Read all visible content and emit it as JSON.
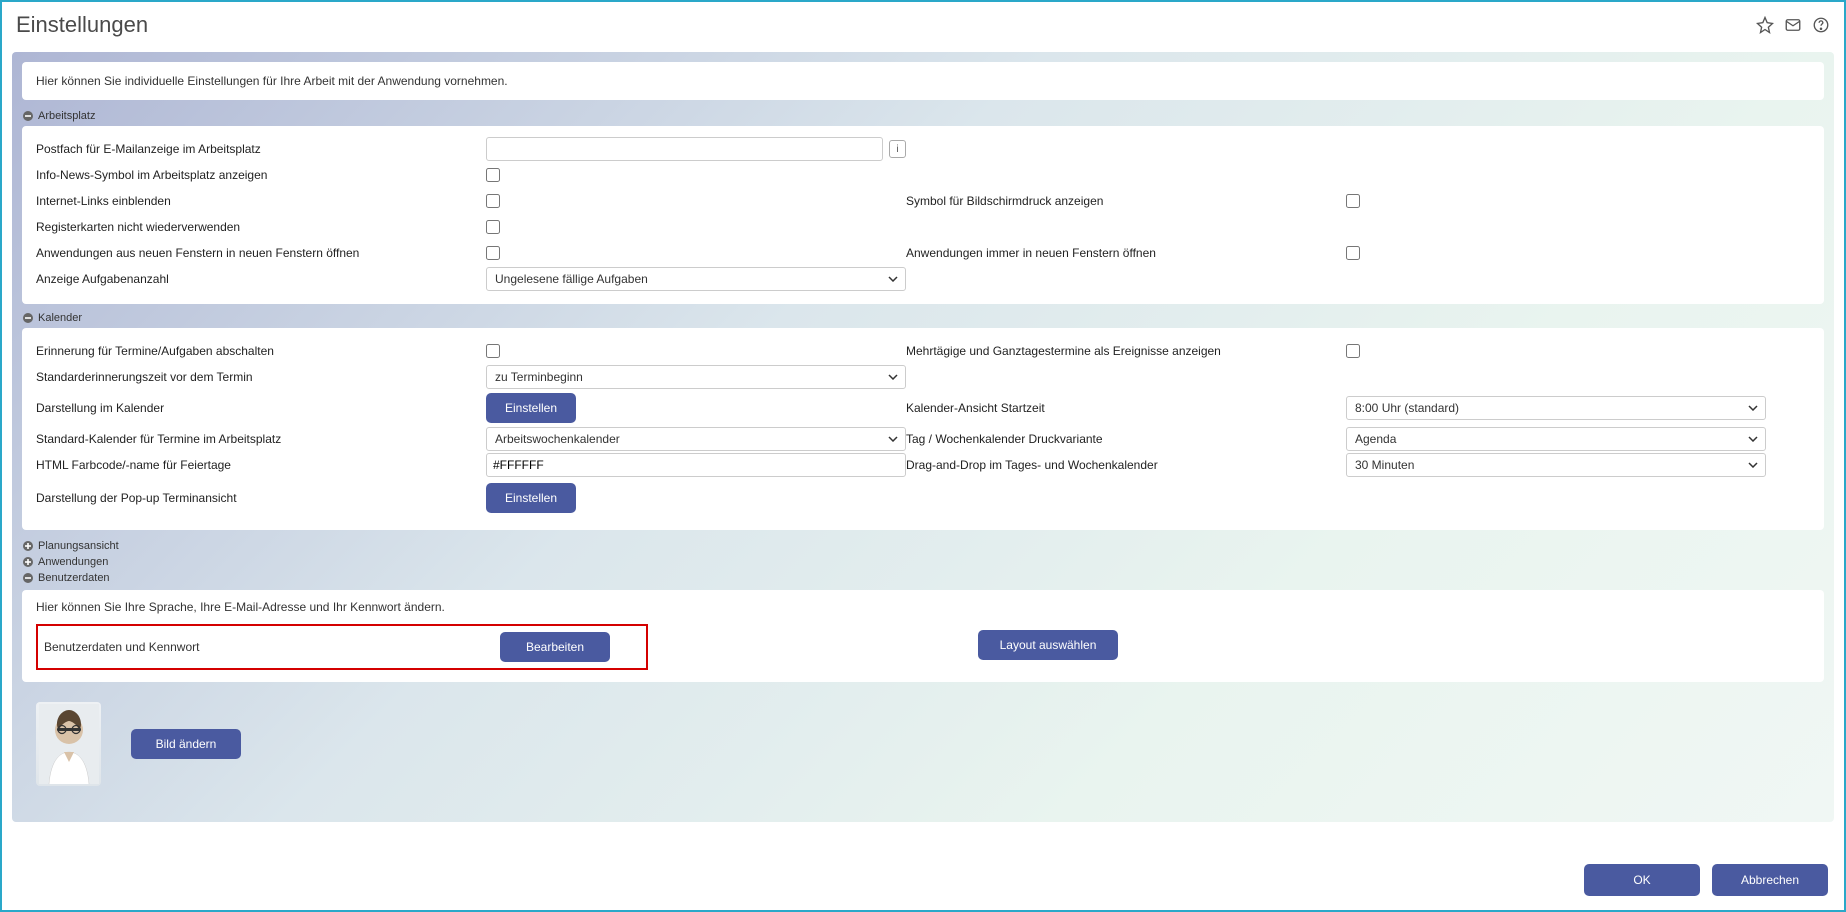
{
  "page": {
    "title": "Einstellungen"
  },
  "intro": "Hier können Sie individuelle Einstellungen für Ihre Arbeit mit der Anwendung vornehmen.",
  "sections": {
    "arbeitsplatz": {
      "title": "Arbeitsplatz",
      "postfach_label": "Postfach für E-Mailanzeige im Arbeitsplatz",
      "postfach_value": "",
      "infonews_label": "Info-News-Symbol im Arbeitsplatz anzeigen",
      "internetlinks_label": "Internet-Links einblenden",
      "bildschirmdruck_label": "Symbol für Bildschirmdruck anzeigen",
      "register_label": "Registerkarten nicht wiederverwenden",
      "neuefenster_label": "Anwendungen aus neuen Fenstern in neuen Fenstern öffnen",
      "immerneuefenster_label": "Anwendungen immer in neuen Fenstern öffnen",
      "aufgabenanz_label": "Anzeige Aufgabenanzahl",
      "aufgabenanz_value": "Ungelesene fällige Aufgaben"
    },
    "kalender": {
      "title": "Kalender",
      "erinnerung_label": "Erinnerung für Termine/Aufgaben abschalten",
      "mehrtagig_label": "Mehrtägige und Ganztagestermine als Ereignisse anzeigen",
      "stderinnerung_label": "Standarderinnerungszeit vor dem Termin",
      "stderinnerung_value": "zu Terminbeginn",
      "darstellung_label": "Darstellung im Kalender",
      "darstellung_btn": "Einstellen",
      "startzeit_label": "Kalender-Ansicht Startzeit",
      "startzeit_value": "8:00 Uhr (standard)",
      "stdkal_label": "Standard-Kalender für Termine im Arbeitsplatz",
      "stdkal_value": "Arbeitswochenkalender",
      "druckvar_label": "Tag / Wochenkalender Druckvariante",
      "druckvar_value": "Agenda",
      "farbcode_label": "HTML Farbcode/-name für Feiertage",
      "farbcode_value": "#FFFFFF",
      "dragdrop_label": "Drag-and-Drop im Tages- und Wochenkalender",
      "dragdrop_value": "30 Minuten",
      "popup_label": "Darstellung der Pop-up Terminansicht",
      "popup_btn": "Einstellen"
    },
    "collapsed": {
      "planung": "Planungsansicht",
      "anwendungen": "Anwendungen",
      "benutzerdaten": "Benutzerdaten"
    },
    "benutzerdaten": {
      "intro": "Hier können Sie Ihre Sprache, Ihre E-Mail-Adresse und Ihr Kennwort ändern.",
      "bk_label": "Benutzerdaten und Kennwort",
      "bk_btn": "Bearbeiten",
      "layout_btn": "Layout auswählen",
      "bild_btn": "Bild ändern"
    }
  },
  "footer": {
    "ok": "OK",
    "cancel": "Abbrechen"
  }
}
